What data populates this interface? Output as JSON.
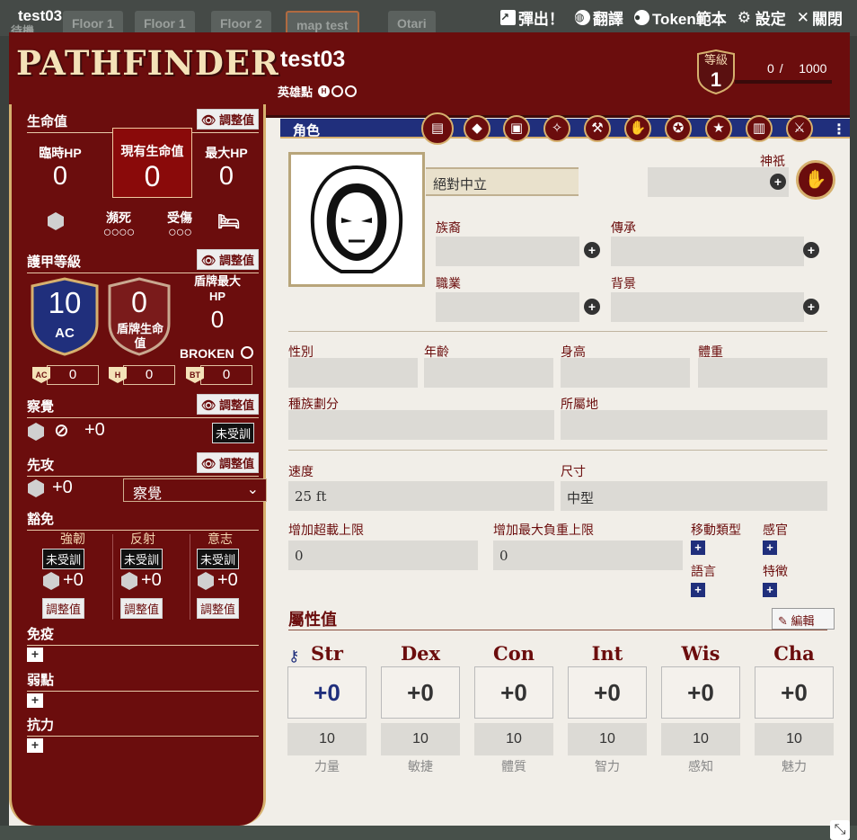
{
  "window": {
    "title": "test03",
    "actions": [
      {
        "icon": "popout-icon",
        "label": "彈出！"
      },
      {
        "icon": "globe-icon",
        "label": "翻譯"
      },
      {
        "icon": "user-circle-icon",
        "label": "Token範本"
      },
      {
        "icon": "gear-icon",
        "label": "設定"
      },
      {
        "icon": "close-icon",
        "label": "關閉"
      }
    ]
  },
  "bg_tabs": [
    "待機",
    "Floor 1",
    "Floor 1",
    "Floor 2",
    "map test",
    "Otari"
  ],
  "header": {
    "logo": "PATHFINDER",
    "name": "test03",
    "hero_points_label": "英雄點",
    "hero_marker": "H",
    "level_label": "等級",
    "level": "1",
    "xp_current": "0",
    "xp_sep": "/",
    "xp_max": "1000"
  },
  "sidebar": {
    "hp": {
      "section": "生命值",
      "adjust": "調整值",
      "temp_label": "臨時HP",
      "temp": "0",
      "current_label": "現有生命值",
      "current": "0",
      "max_label": "最大HP",
      "max": "0",
      "dying_label": "瀕死",
      "dying": "○○○○",
      "wounded_label": "受傷",
      "wounded": "○○○"
    },
    "ac": {
      "section": "護甲等級",
      "adjust": "調整值",
      "ac": "10",
      "ac_label": "AC",
      "shield": "0",
      "shield_label": "盾牌生命值",
      "shield_max_label": "盾牌最大HP",
      "shield_max": "0",
      "broken_label": "BROKEN",
      "abbr": [
        {
          "tag": "AC",
          "val": "0"
        },
        {
          "tag": "H",
          "val": "0"
        },
        {
          "tag": "BT",
          "val": "0"
        }
      ]
    },
    "perception": {
      "section": "察覺",
      "adjust": "調整值",
      "mod": "+0",
      "rank": "未受訓"
    },
    "initiative": {
      "section": "先攻",
      "adjust": "調整值",
      "mod": "+0",
      "skill": "察覺"
    },
    "saves": {
      "section": "豁免",
      "items": [
        {
          "name": "強韌",
          "rank": "未受訓",
          "mod": "+0",
          "adjust": "調整值"
        },
        {
          "name": "反射",
          "rank": "未受訓",
          "mod": "+0",
          "adjust": "調整值"
        },
        {
          "name": "意志",
          "rank": "未受訓",
          "mod": "+0",
          "adjust": "調整值"
        }
      ]
    },
    "immunities": "免疫",
    "weaknesses": "弱點",
    "resistances": "抗力"
  },
  "main": {
    "role_label": "角色",
    "tabs": [
      "id-card-icon",
      "tag-icon",
      "box-icon",
      "wand-icon",
      "hammer-icon",
      "hand-icon",
      "medal-icon",
      "star-icon",
      "book-icon",
      "swords-icon"
    ],
    "alignment": "絕對中立",
    "deity_label": "神祇",
    "ancestry_label": "族裔",
    "heritage_label": "傳承",
    "class_label": "職業",
    "background_label": "背景",
    "gender_label": "性別",
    "age_label": "年齡",
    "height_label": "身高",
    "weight_label": "體重",
    "ethnicity_label": "種族劃分",
    "nationality_label": "所屬地",
    "speed_label": "速度",
    "speed": "25 ft",
    "size_label": "尺寸",
    "size": "中型",
    "bulk_over_label": "增加超載上限",
    "bulk_over": "0",
    "bulk_max_label": "增加最大負重上限",
    "bulk_max": "0",
    "move_types_label": "移動類型",
    "senses_label": "感官",
    "languages_label": "語言",
    "traits_label": "特徵",
    "attributes_label": "屬性值",
    "edit_label": "編輯",
    "abilities": [
      {
        "abbr": "Str",
        "mod": "+0",
        "score": "10",
        "name": "力量"
      },
      {
        "abbr": "Dex",
        "mod": "+0",
        "score": "10",
        "name": "敏捷"
      },
      {
        "abbr": "Con",
        "mod": "+0",
        "score": "10",
        "name": "體質"
      },
      {
        "abbr": "Int",
        "mod": "+0",
        "score": "10",
        "name": "智力"
      },
      {
        "abbr": "Wis",
        "mod": "+0",
        "score": "10",
        "name": "感知"
      },
      {
        "abbr": "Cha",
        "mod": "+0",
        "score": "10",
        "name": "魅力"
      }
    ]
  },
  "colors": {
    "crimson": "#6b0d0d",
    "navy": "#202f7c",
    "gold": "#d6b06e",
    "parchment": "#f1eee8"
  }
}
